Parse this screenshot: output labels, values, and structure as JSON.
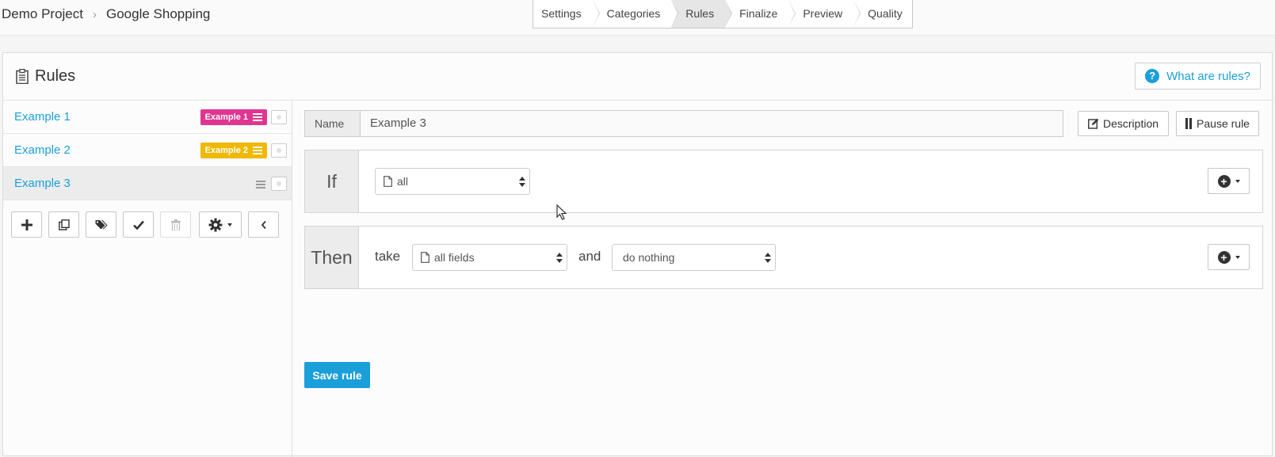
{
  "breadcrumb": {
    "project": "Demo Project",
    "channel": "Google Shopping"
  },
  "steps": [
    "Settings",
    "Categories",
    "Rules",
    "Finalize",
    "Preview",
    "Quality"
  ],
  "active_step": "Rules",
  "panel": {
    "title": "Rules",
    "help_label": "What are rules?"
  },
  "rules": [
    {
      "label": "Example 1",
      "tag": "Example 1",
      "tag_color": "#e0368f"
    },
    {
      "label": "Example 2",
      "tag": "Example 2",
      "tag_color": "#f0b800"
    },
    {
      "label": "Example 3",
      "tag": "",
      "tag_color": ""
    }
  ],
  "toolbar_icons": [
    "plus-icon",
    "copy-icon",
    "tags-icon",
    "check-icon",
    "trash-icon",
    "gear-icon",
    "chevron-left-icon"
  ],
  "editor": {
    "name_label": "Name",
    "name_value": "Example 3",
    "description_label": "Description",
    "pause_label": "Pause rule",
    "if_label": "If",
    "if_select": "all",
    "then_label": "Then",
    "take_word": "take",
    "take_select": "all fields",
    "and_word": "and",
    "action_select": "do nothing",
    "save_label": "Save rule"
  },
  "colors": {
    "accent": "#1a9fd9"
  }
}
